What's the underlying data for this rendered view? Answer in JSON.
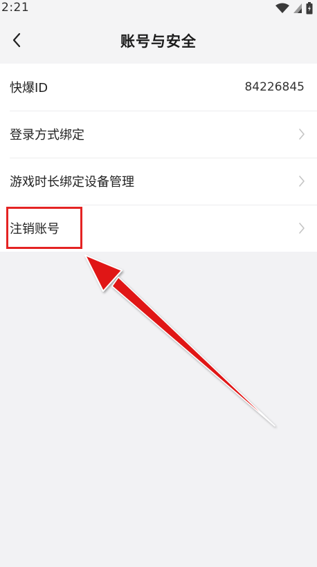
{
  "status_bar": {
    "time": "2:21",
    "icons": [
      "wifi-icon",
      "cellular-signal-icon",
      "battery-icon"
    ]
  },
  "header": {
    "back_icon": "chevron-left-icon",
    "title": "账号与安全"
  },
  "settings": {
    "items": [
      {
        "label": "快爆ID",
        "value": "84226845"
      },
      {
        "label": "登录方式绑定",
        "icon": "chevron-right-icon"
      },
      {
        "label": "游戏时长绑定设备管理",
        "icon": "chevron-right-icon"
      },
      {
        "label": "注销账号",
        "icon": "chevron-right-icon"
      }
    ]
  },
  "colors": {
    "background": "#f2f2f4",
    "list_background": "#ffffff",
    "highlight": "#e42323",
    "chevron": "#c4c4c4"
  }
}
